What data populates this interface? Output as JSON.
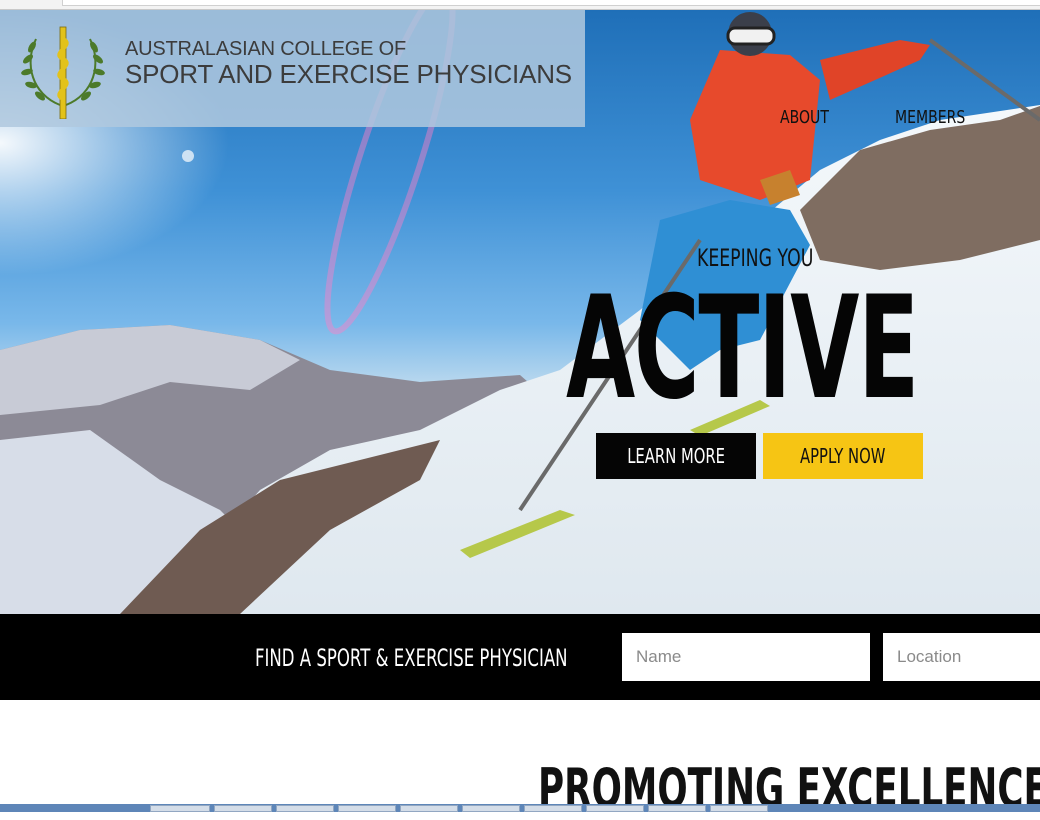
{
  "logo": {
    "line1": "AUSTRALASIAN COLLEGE OF",
    "line2": "SPORT AND EXERCISE PHYSICIANS",
    "emblem_colors": {
      "wreath": "#4c7a2a",
      "staff": "#e2c21a"
    }
  },
  "nav": {
    "items": [
      {
        "label": "ABOUT"
      },
      {
        "label": "MEMBERS"
      }
    ]
  },
  "hero": {
    "tagline": "KEEPING YOU",
    "headline": "ACTIVE",
    "learn_more_label": "LEARN MORE",
    "apply_now_label": "APPLY NOW",
    "accent_color": "#f6c514"
  },
  "find": {
    "title": "FIND A SPORT & EXERCISE PHYSICIAN",
    "name_placeholder": "Name",
    "location_placeholder": "Location"
  },
  "section": {
    "title": "PROMOTING EXCELLENCE"
  }
}
